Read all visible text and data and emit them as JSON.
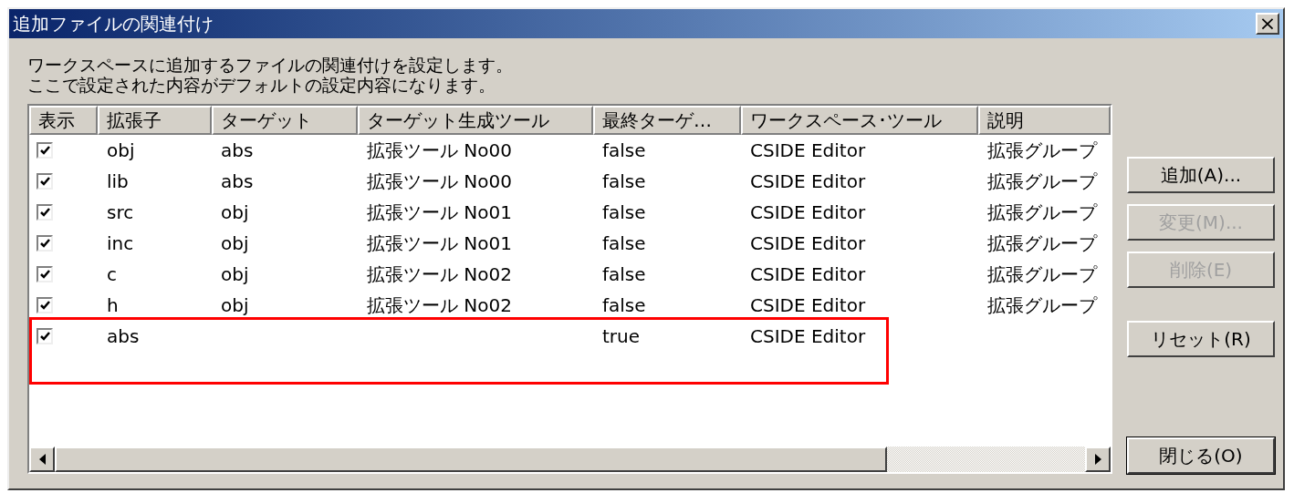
{
  "window": {
    "title": "追加ファイルの関連付け",
    "close": "×"
  },
  "description": [
    "ワークスペースに追加するファイルの関連付けを設定します。",
    "ここで設定された内容がデフォルトの設定内容になります。"
  ],
  "table": {
    "columns": [
      "表示",
      "拡張子",
      "ターゲット",
      "ターゲット生成ツール",
      "最終ターゲ…",
      "ワークスペース･ツール",
      "説明"
    ],
    "rows": [
      {
        "checked": true,
        "highlighted": false,
        "cells": [
          "",
          "obj",
          "abs",
          "拡張ツール No00",
          "false",
          "CSIDE Editor",
          "拡張グループ"
        ]
      },
      {
        "checked": true,
        "highlighted": false,
        "cells": [
          "",
          "lib",
          "abs",
          "拡張ツール No00",
          "false",
          "CSIDE Editor",
          "拡張グループ"
        ]
      },
      {
        "checked": true,
        "highlighted": false,
        "cells": [
          "",
          "src",
          "obj",
          "拡張ツール No01",
          "false",
          "CSIDE Editor",
          "拡張グループ"
        ]
      },
      {
        "checked": true,
        "highlighted": false,
        "cells": [
          "",
          "inc",
          "obj",
          "拡張ツール No01",
          "false",
          "CSIDE Editor",
          "拡張グループ"
        ]
      },
      {
        "checked": true,
        "highlighted": false,
        "cells": [
          "",
          "c",
          "obj",
          "拡張ツール No02",
          "false",
          "CSIDE Editor",
          "拡張グループ"
        ]
      },
      {
        "checked": true,
        "highlighted": false,
        "cells": [
          "",
          "h",
          "obj",
          "拡張ツール No02",
          "false",
          "CSIDE Editor",
          "拡張グループ"
        ]
      },
      {
        "checked": true,
        "highlighted": true,
        "cells": [
          "",
          "abs",
          "",
          "",
          "true",
          "CSIDE Editor",
          ""
        ]
      }
    ]
  },
  "buttons": [
    {
      "label": "追加(A)...",
      "disabled": false,
      "kind": "top"
    },
    {
      "label": "変更(M)...",
      "disabled": true,
      "kind": "top"
    },
    {
      "label": "削除(E)",
      "disabled": true,
      "kind": "top"
    },
    {
      "label": "リセット(R)",
      "disabled": false,
      "kind": "reset"
    },
    {
      "label": "閉じる(O)",
      "disabled": false,
      "kind": "close"
    }
  ]
}
